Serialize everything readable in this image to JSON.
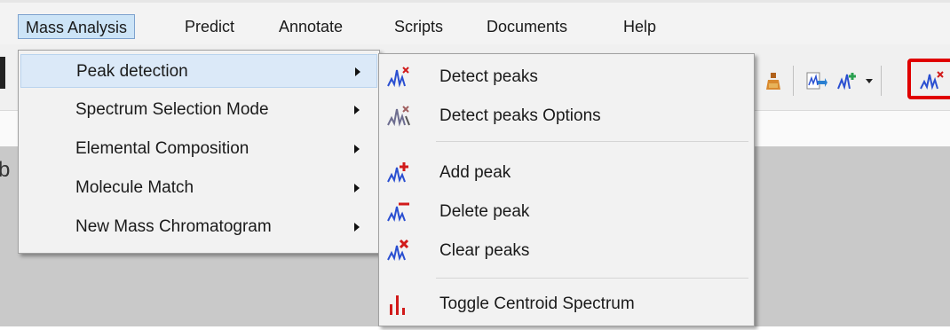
{
  "menubar": {
    "items": [
      "Mass Analysis",
      "Predict",
      "Annotate",
      "Scripts",
      "Documents",
      "Help"
    ]
  },
  "mass_analysis_menu": {
    "items": [
      {
        "label": "Peak detection",
        "has_submenu": true
      },
      {
        "label": "Spectrum Selection Mode",
        "has_submenu": true
      },
      {
        "label": "Elemental Composition",
        "has_submenu": true
      },
      {
        "label": "Molecule Match",
        "has_submenu": true
      },
      {
        "label": "New Mass Chromatogram",
        "has_submenu": true
      }
    ]
  },
  "peak_detection_submenu": {
    "items": [
      {
        "label": "Detect peaks",
        "icon": "detect-peaks-icon"
      },
      {
        "label": "Detect peaks Options",
        "icon": "detect-peaks-options-icon"
      },
      {
        "label": "Add peak",
        "icon": "add-peak-icon"
      },
      {
        "label": "Delete peak",
        "icon": "delete-peak-icon"
      },
      {
        "label": "Clear peaks",
        "icon": "clear-peaks-icon"
      },
      {
        "label": "Toggle Centroid Spectrum",
        "icon": "bar-chart-icon"
      }
    ]
  },
  "colors": {
    "highlight_box": "#e00000",
    "menu_hover": "#dbe9f8",
    "peak_icon_blue": "#2a4fd1",
    "peak_icon_red": "#d11a1a"
  }
}
